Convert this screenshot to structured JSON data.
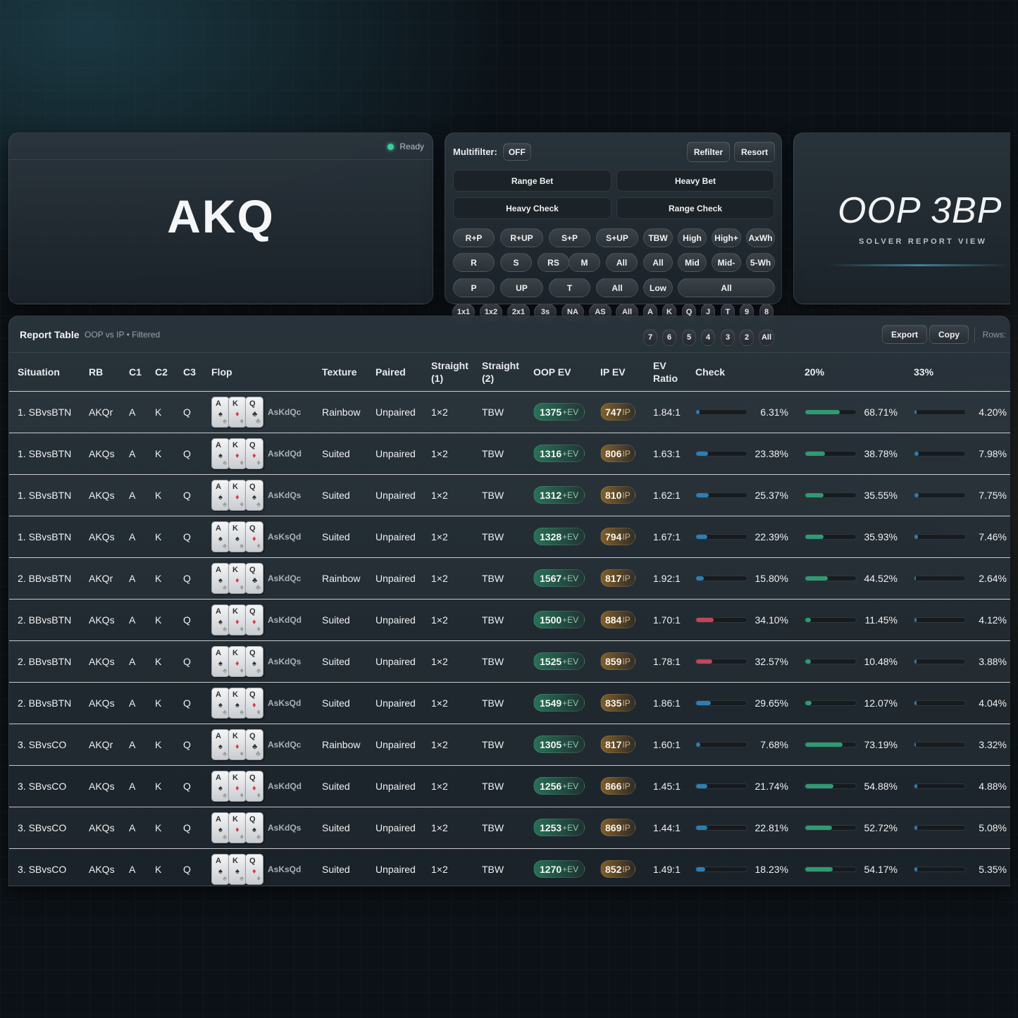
{
  "hero": {
    "status": "Ready",
    "board": "AKQ"
  },
  "multifilter": {
    "label": "Multifilter:",
    "toggle": "OFF",
    "refilter": "Refilter",
    "resort": "Resort",
    "range_bet": "Range Bet",
    "heavy_bet": "Heavy Bet",
    "heavy_check": "Heavy Check",
    "range_check": "Range Check",
    "row1": [
      "R+P",
      "R+UP",
      "S+P",
      "S+UP",
      "TBW",
      "High",
      "High+",
      "AxWh"
    ],
    "row2": [
      "R",
      "S",
      "RS",
      "M",
      "All",
      "All",
      "Mid",
      "Mid-",
      "5-Wh"
    ],
    "row3": [
      "P",
      "UP",
      "T",
      "All",
      "Low",
      "All"
    ],
    "row4": [
      "1x1",
      "1x2",
      "2x1",
      "3s",
      "NA",
      "AS",
      "All",
      "A",
      "K",
      "Q",
      "J",
      "T",
      "9",
      "8"
    ],
    "row5": [
      "7",
      "6",
      "5",
      "4",
      "3",
      "2",
      "All"
    ]
  },
  "titlecard": {
    "title": "OOP 3BP",
    "subtitle": "SOLVER REPORT VIEW"
  },
  "report": {
    "title": "Report Table",
    "subtitle": "OOP vs IP • Filtered",
    "export": "Export",
    "copy": "Copy",
    "rows_label": "Rows:",
    "columns": [
      "Situation",
      "RB",
      "C1",
      "C2",
      "C3",
      "Flop",
      "Texture",
      "Paired",
      "Straight (1)",
      "Straight (2)",
      "OOP EV",
      "IP EV",
      "EV Ratio",
      "Check",
      "20%",
      "33%"
    ],
    "oop_suffix": "+EV",
    "ip_suffix": "IP",
    "colors": {
      "check_blue": "#2b7fb4",
      "check_red": "#c0455a",
      "green": "#2e9b72",
      "oop_badge": "#287a5a",
      "ip_badge": "#8c6428"
    },
    "rows": [
      {
        "situation": "1. SBvsBTN",
        "rb": "AKQr",
        "c1": "A",
        "c2": "K",
        "c3": "Q",
        "suits": [
          "s",
          "d",
          "c"
        ],
        "flop": "AsKdQc",
        "texture": "Rainbow",
        "paired": "Unpaired",
        "s1": "1×2",
        "s2": "TBW",
        "oop": "1375",
        "ip": "747",
        "ratio": "1.84:1",
        "check": "6.31%",
        "check_v": 6.31,
        "check_color": "#2b7fb4",
        "b20": "68.71%",
        "b20_v": 68.71,
        "b33": "4.20%",
        "b33_v": 4.2
      },
      {
        "situation": "1. SBvsBTN",
        "rb": "AKQs",
        "c1": "A",
        "c2": "K",
        "c3": "Q",
        "suits": [
          "s",
          "d",
          "d"
        ],
        "flop": "AsKdQd",
        "texture": "Suited",
        "paired": "Unpaired",
        "s1": "1×2",
        "s2": "TBW",
        "oop": "1316",
        "ip": "806",
        "ratio": "1.63:1",
        "check": "23.38%",
        "check_v": 23.38,
        "check_color": "#2b7fb4",
        "b20": "38.78%",
        "b20_v": 38.78,
        "b33": "7.98%",
        "b33_v": 7.98
      },
      {
        "situation": "1. SBvsBTN",
        "rb": "AKQs",
        "c1": "A",
        "c2": "K",
        "c3": "Q",
        "suits": [
          "s",
          "d",
          "s"
        ],
        "flop": "AsKdQs",
        "texture": "Suited",
        "paired": "Unpaired",
        "s1": "1×2",
        "s2": "TBW",
        "oop": "1312",
        "ip": "810",
        "ratio": "1.62:1",
        "check": "25.37%",
        "check_v": 25.37,
        "check_color": "#2b7fb4",
        "b20": "35.55%",
        "b20_v": 35.55,
        "b33": "7.75%",
        "b33_v": 7.75
      },
      {
        "situation": "1. SBvsBTN",
        "rb": "AKQs",
        "c1": "A",
        "c2": "K",
        "c3": "Q",
        "suits": [
          "s",
          "s",
          "d"
        ],
        "flop": "AsKsQd",
        "texture": "Suited",
        "paired": "Unpaired",
        "s1": "1×2",
        "s2": "TBW",
        "oop": "1328",
        "ip": "794",
        "ratio": "1.67:1",
        "check": "22.39%",
        "check_v": 22.39,
        "check_color": "#2b7fb4",
        "b20": "35.93%",
        "b20_v": 35.93,
        "b33": "7.46%",
        "b33_v": 7.46
      },
      {
        "situation": "2. BBvsBTN",
        "rb": "AKQr",
        "c1": "A",
        "c2": "K",
        "c3": "Q",
        "suits": [
          "s",
          "d",
          "c"
        ],
        "flop": "AsKdQc",
        "texture": "Rainbow",
        "paired": "Unpaired",
        "s1": "1×2",
        "s2": "TBW",
        "oop": "1567",
        "ip": "817",
        "ratio": "1.92:1",
        "check": "15.80%",
        "check_v": 15.8,
        "check_color": "#2b7fb4",
        "b20": "44.52%",
        "b20_v": 44.52,
        "b33": "2.64%",
        "b33_v": 2.64
      },
      {
        "situation": "2. BBvsBTN",
        "rb": "AKQs",
        "c1": "A",
        "c2": "K",
        "c3": "Q",
        "suits": [
          "s",
          "d",
          "d"
        ],
        "flop": "AsKdQd",
        "texture": "Suited",
        "paired": "Unpaired",
        "s1": "1×2",
        "s2": "TBW",
        "oop": "1500",
        "ip": "884",
        "ratio": "1.70:1",
        "check": "34.10%",
        "check_v": 34.1,
        "check_color": "#c0455a",
        "b20": "11.45%",
        "b20_v": 11.45,
        "b33": "4.12%",
        "b33_v": 4.12
      },
      {
        "situation": "2. BBvsBTN",
        "rb": "AKQs",
        "c1": "A",
        "c2": "K",
        "c3": "Q",
        "suits": [
          "s",
          "d",
          "s"
        ],
        "flop": "AsKdQs",
        "texture": "Suited",
        "paired": "Unpaired",
        "s1": "1×2",
        "s2": "TBW",
        "oop": "1525",
        "ip": "859",
        "ratio": "1.78:1",
        "check": "32.57%",
        "check_v": 32.57,
        "check_color": "#c0455a",
        "b20": "10.48%",
        "b20_v": 10.48,
        "b33": "3.88%",
        "b33_v": 3.88
      },
      {
        "situation": "2. BBvsBTN",
        "rb": "AKQs",
        "c1": "A",
        "c2": "K",
        "c3": "Q",
        "suits": [
          "s",
          "s",
          "d"
        ],
        "flop": "AsKsQd",
        "texture": "Suited",
        "paired": "Unpaired",
        "s1": "1×2",
        "s2": "TBW",
        "oop": "1549",
        "ip": "835",
        "ratio": "1.86:1",
        "check": "29.65%",
        "check_v": 29.65,
        "check_color": "#2b7fb4",
        "b20": "12.07%",
        "b20_v": 12.07,
        "b33": "4.04%",
        "b33_v": 4.04
      },
      {
        "situation": "3. SBvsCO",
        "rb": "AKQr",
        "c1": "A",
        "c2": "K",
        "c3": "Q",
        "suits": [
          "s",
          "d",
          "c"
        ],
        "flop": "AsKdQc",
        "texture": "Rainbow",
        "paired": "Unpaired",
        "s1": "1×2",
        "s2": "TBW",
        "oop": "1305",
        "ip": "817",
        "ratio": "1.60:1",
        "check": "7.68%",
        "check_v": 7.68,
        "check_color": "#2b7fb4",
        "b20": "73.19%",
        "b20_v": 73.19,
        "b33": "3.32%",
        "b33_v": 3.32
      },
      {
        "situation": "3. SBvsCO",
        "rb": "AKQs",
        "c1": "A",
        "c2": "K",
        "c3": "Q",
        "suits": [
          "s",
          "d",
          "d"
        ],
        "flop": "AsKdQd",
        "texture": "Suited",
        "paired": "Unpaired",
        "s1": "1×2",
        "s2": "TBW",
        "oop": "1256",
        "ip": "866",
        "ratio": "1.45:1",
        "check": "21.74%",
        "check_v": 21.74,
        "check_color": "#2b7fb4",
        "b20": "54.88%",
        "b20_v": 54.88,
        "b33": "4.88%",
        "b33_v": 4.88
      },
      {
        "situation": "3. SBvsCO",
        "rb": "AKQs",
        "c1": "A",
        "c2": "K",
        "c3": "Q",
        "suits": [
          "s",
          "d",
          "s"
        ],
        "flop": "AsKdQs",
        "texture": "Suited",
        "paired": "Unpaired",
        "s1": "1×2",
        "s2": "TBW",
        "oop": "1253",
        "ip": "869",
        "ratio": "1.44:1",
        "check": "22.81%",
        "check_v": 22.81,
        "check_color": "#2b7fb4",
        "b20": "52.72%",
        "b20_v": 52.72,
        "b33": "5.08%",
        "b33_v": 5.08
      },
      {
        "situation": "3. SBvsCO",
        "rb": "AKQs",
        "c1": "A",
        "c2": "K",
        "c3": "Q",
        "suits": [
          "s",
          "s",
          "d"
        ],
        "flop": "AsKsQd",
        "texture": "Suited",
        "paired": "Unpaired",
        "s1": "1×2",
        "s2": "TBW",
        "oop": "1270",
        "ip": "852",
        "ratio": "1.49:1",
        "check": "18.23%",
        "check_v": 18.23,
        "check_color": "#2b7fb4",
        "b20": "54.17%",
        "b20_v": 54.17,
        "b33": "5.35%",
        "b33_v": 5.35
      }
    ]
  }
}
